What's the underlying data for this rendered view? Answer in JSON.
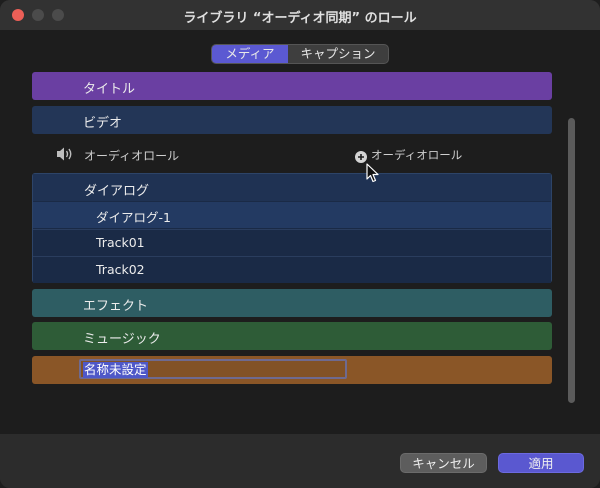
{
  "window": {
    "title": "ライブラリ “オーディオ同期” のロール"
  },
  "tabs": {
    "media": "メディア",
    "captions": "キャプション"
  },
  "video_roles": [
    {
      "label": "タイトル"
    },
    {
      "label": "ビデオ"
    }
  ],
  "audio": {
    "header_label": "オーディオロール",
    "add_label": "オーディオロール"
  },
  "dialogue": {
    "label": "ダイアログ",
    "subroles": [
      {
        "label": "ダイアログ-1"
      },
      {
        "label": "Track01"
      },
      {
        "label": "Track02"
      }
    ]
  },
  "effects": {
    "label": "エフェクト"
  },
  "music": {
    "label": "ミュージック"
  },
  "new_role": {
    "value": "名称未設定"
  },
  "buttons": {
    "cancel": "キャンセル",
    "apply": "適用"
  },
  "colors": {
    "titles": "#6a3fa2",
    "video": "#233657",
    "dialogue": "#1f3253",
    "effects": "#2e5d63",
    "music": "#2e5c37",
    "unnamed": "#8a5627",
    "accent": "#5a58d0"
  }
}
